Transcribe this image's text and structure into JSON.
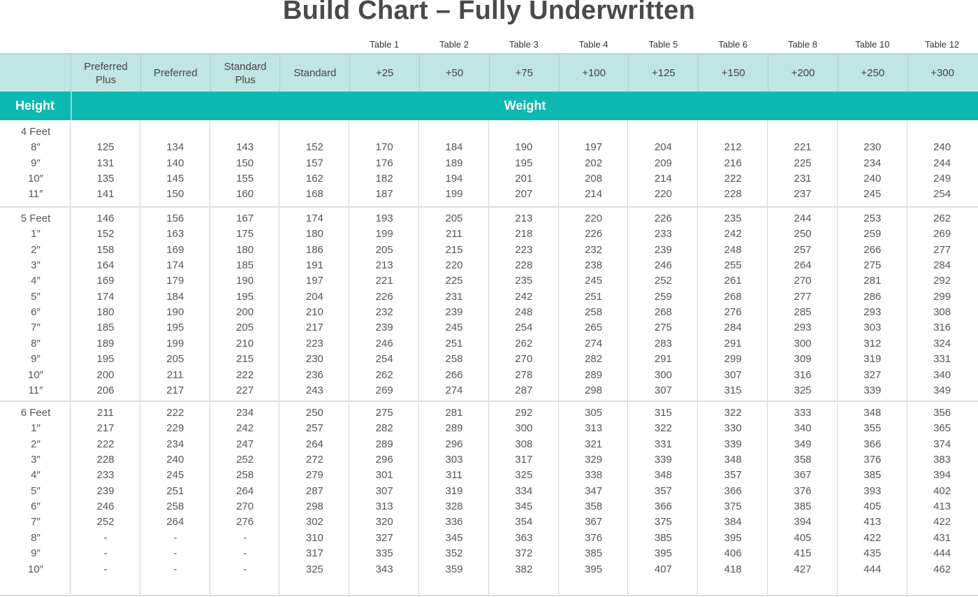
{
  "title": "Build Chart – Fully Underwritten",
  "table_labels": [
    "Table 1",
    "Table 2",
    "Table 3",
    "Table 4",
    "Table 5",
    "Table 6",
    "Table 8",
    "Table 10",
    "Table 12"
  ],
  "categories": [
    "Preferred Plus",
    "Preferred",
    "Standard Plus",
    "Standard",
    "+25",
    "+50",
    "+75",
    "+100",
    "+125",
    "+150",
    "+200",
    "+250",
    "+300"
  ],
  "band": {
    "height_label": "Height",
    "weight_label": "Weight"
  },
  "accent_color": "#0bb8b2",
  "header_bg_color": "#bfe6e3",
  "groups": [
    {
      "label": "4 Feet",
      "rows": [
        {
          "h": "8″",
          "v": [
            "125",
            "134",
            "143",
            "152",
            "170",
            "184",
            "190",
            "197",
            "204",
            "212",
            "221",
            "230",
            "240"
          ]
        },
        {
          "h": "9″",
          "v": [
            "131",
            "140",
            "150",
            "157",
            "176",
            "189",
            "195",
            "202",
            "209",
            "216",
            "225",
            "234",
            "244"
          ]
        },
        {
          "h": "10″",
          "v": [
            "135",
            "145",
            "155",
            "162",
            "182",
            "194",
            "201",
            "208",
            "214",
            "222",
            "231",
            "240",
            "249"
          ]
        },
        {
          "h": "11″",
          "v": [
            "141",
            "150",
            "160",
            "168",
            "187",
            "199",
            "207",
            "214",
            "220",
            "228",
            "237",
            "245",
            "254"
          ]
        }
      ]
    },
    {
      "label": "5 Feet",
      "first": [
        "146",
        "156",
        "167",
        "174",
        "193",
        "205",
        "213",
        "220",
        "226",
        "235",
        "244",
        "253",
        "262"
      ],
      "rows": [
        {
          "h": "1″",
          "v": [
            "152",
            "163",
            "175",
            "180",
            "199",
            "211",
            "218",
            "226",
            "233",
            "242",
            "250",
            "259",
            "269"
          ]
        },
        {
          "h": "2″",
          "v": [
            "158",
            "169",
            "180",
            "186",
            "205",
            "215",
            "223",
            "232",
            "239",
            "248",
            "257",
            "266",
            "277"
          ]
        },
        {
          "h": "3″",
          "v": [
            "164",
            "174",
            "185",
            "191",
            "213",
            "220",
            "228",
            "238",
            "246",
            "255",
            "264",
            "275",
            "284"
          ]
        },
        {
          "h": "4″",
          "v": [
            "169",
            "179",
            "190",
            "197",
            "221",
            "225",
            "235",
            "245",
            "252",
            "261",
            "270",
            "281",
            "292"
          ]
        },
        {
          "h": "5″",
          "v": [
            "174",
            "184",
            "195",
            "204",
            "226",
            "231",
            "242",
            "251",
            "259",
            "268",
            "277",
            "286",
            "299"
          ]
        },
        {
          "h": "6″",
          "v": [
            "180",
            "190",
            "200",
            "210",
            "232",
            "239",
            "248",
            "258",
            "268",
            "276",
            "285",
            "293",
            "308"
          ]
        },
        {
          "h": "7″",
          "v": [
            "185",
            "195",
            "205",
            "217",
            "239",
            "245",
            "254",
            "265",
            "275",
            "284",
            "293",
            "303",
            "316"
          ]
        },
        {
          "h": "8″",
          "v": [
            "189",
            "199",
            "210",
            "223",
            "246",
            "251",
            "262",
            "274",
            "283",
            "291",
            "300",
            "312",
            "324"
          ]
        },
        {
          "h": "9″",
          "v": [
            "195",
            "205",
            "215",
            "230",
            "254",
            "258",
            "270",
            "282",
            "291",
            "299",
            "309",
            "319",
            "331"
          ]
        },
        {
          "h": "10″",
          "v": [
            "200",
            "211",
            "222",
            "236",
            "262",
            "266",
            "278",
            "289",
            "300",
            "307",
            "316",
            "327",
            "340"
          ]
        },
        {
          "h": "11″",
          "v": [
            "206",
            "217",
            "227",
            "243",
            "269",
            "274",
            "287",
            "298",
            "307",
            "315",
            "325",
            "339",
            "349"
          ]
        }
      ]
    },
    {
      "label": "6 Feet",
      "first": [
        "211",
        "222",
        "234",
        "250",
        "275",
        "281",
        "292",
        "305",
        "315",
        "322",
        "333",
        "348",
        "356"
      ],
      "rows": [
        {
          "h": "1″",
          "v": [
            "217",
            "229",
            "242",
            "257",
            "282",
            "289",
            "300",
            "313",
            "322",
            "330",
            "340",
            "355",
            "365"
          ]
        },
        {
          "h": "2″",
          "v": [
            "222",
            "234",
            "247",
            "264",
            "289",
            "296",
            "308",
            "321",
            "331",
            "339",
            "349",
            "366",
            "374"
          ]
        },
        {
          "h": "3″",
          "v": [
            "228",
            "240",
            "252",
            "272",
            "296",
            "303",
            "317",
            "329",
            "339",
            "348",
            "358",
            "376",
            "383"
          ]
        },
        {
          "h": "4″",
          "v": [
            "233",
            "245",
            "258",
            "279",
            "301",
            "311",
            "325",
            "338",
            "348",
            "357",
            "367",
            "385",
            "394"
          ]
        },
        {
          "h": "5″",
          "v": [
            "239",
            "251",
            "264",
            "287",
            "307",
            "319",
            "334",
            "347",
            "357",
            "366",
            "376",
            "393",
            "402"
          ]
        },
        {
          "h": "6″",
          "v": [
            "246",
            "258",
            "270",
            "298",
            "313",
            "328",
            "345",
            "358",
            "366",
            "375",
            "385",
            "405",
            "413"
          ]
        },
        {
          "h": "7″",
          "v": [
            "252",
            "264",
            "276",
            "302",
            "320",
            "336",
            "354",
            "367",
            "375",
            "384",
            "394",
            "413",
            "422"
          ]
        },
        {
          "h": "8″",
          "v": [
            "-",
            "-",
            "-",
            "310",
            "327",
            "345",
            "363",
            "376",
            "385",
            "395",
            "405",
            "422",
            "431"
          ]
        },
        {
          "h": "9″",
          "v": [
            "-",
            "-",
            "-",
            "317",
            "335",
            "352",
            "372",
            "385",
            "395",
            "406",
            "415",
            "435",
            "444"
          ]
        },
        {
          "h": "10″",
          "v": [
            "-",
            "-",
            "-",
            "325",
            "343",
            "359",
            "382",
            "395",
            "407",
            "418",
            "427",
            "444",
            "462"
          ]
        }
      ]
    }
  ]
}
